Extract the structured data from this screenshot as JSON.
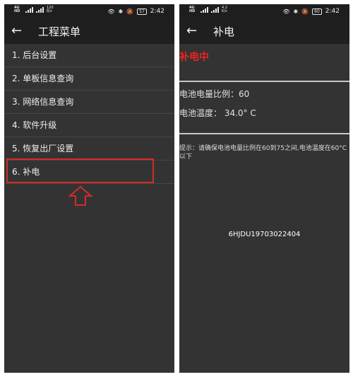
{
  "left": {
    "status": {
      "speed": "120\nB/s",
      "battery": "57",
      "time": "2:42",
      "sim": "4G\nHD"
    },
    "title": "工程菜单",
    "menu": [
      "1. 后台设置",
      "2. 单板信息查询",
      "3. 网络信息查询",
      "4. 软件升级",
      "5. 恢复出厂设置",
      "6. 补电"
    ],
    "highlight_color": "#d62a2a"
  },
  "right": {
    "status": {
      "speed": "4.2\nK/s",
      "battery": "60",
      "time": "2:42",
      "sim": "4G\nHD"
    },
    "title": "补电",
    "state": "补电中",
    "battery_ratio": "电池电量比例：60",
    "battery_temp": "电池温度：  34.0° C",
    "hint": "提示：请确保电池电量比例在60到75之间,电池温度在60°C以下",
    "serial": "6HJDU19703022404",
    "state_color": "#ee2222"
  }
}
